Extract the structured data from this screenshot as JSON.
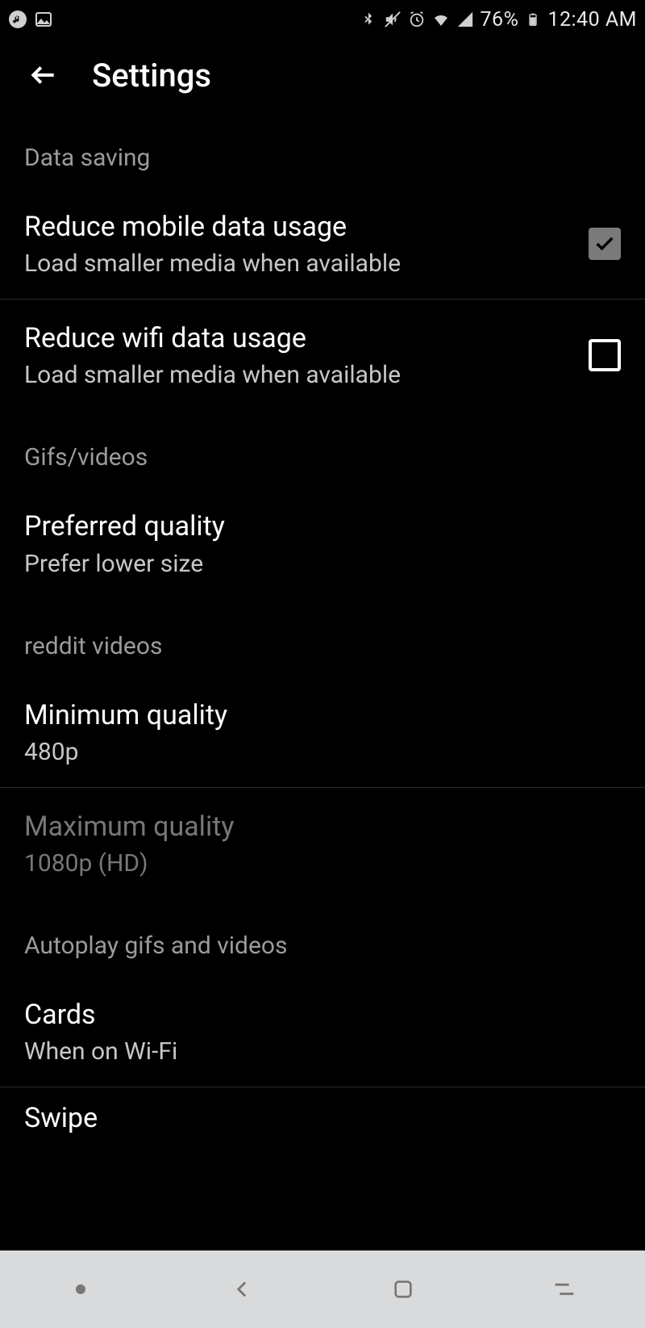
{
  "statusbar": {
    "battery_pct": "76%",
    "clock": "12:40 AM"
  },
  "appbar": {
    "title": "Settings"
  },
  "sections": {
    "data_saving": {
      "header": "Data saving",
      "reduce_mobile": {
        "title": "Reduce mobile data usage",
        "sub": "Load smaller media when available",
        "checked": true
      },
      "reduce_wifi": {
        "title": "Reduce wifi data usage",
        "sub": "Load smaller media when available",
        "checked": false
      }
    },
    "gifs_videos": {
      "header": "Gifs/videos",
      "preferred_quality": {
        "title": "Preferred quality",
        "sub": "Prefer lower size"
      }
    },
    "reddit_videos": {
      "header": "reddit videos",
      "min_quality": {
        "title": "Minimum quality",
        "sub": "480p"
      },
      "max_quality": {
        "title": "Maximum quality",
        "sub": "1080p (HD)"
      }
    },
    "autoplay": {
      "header": "Autoplay gifs and videos",
      "cards": {
        "title": "Cards",
        "sub": "When on Wi-Fi"
      },
      "swipe": {
        "title": "Swipe"
      }
    }
  }
}
